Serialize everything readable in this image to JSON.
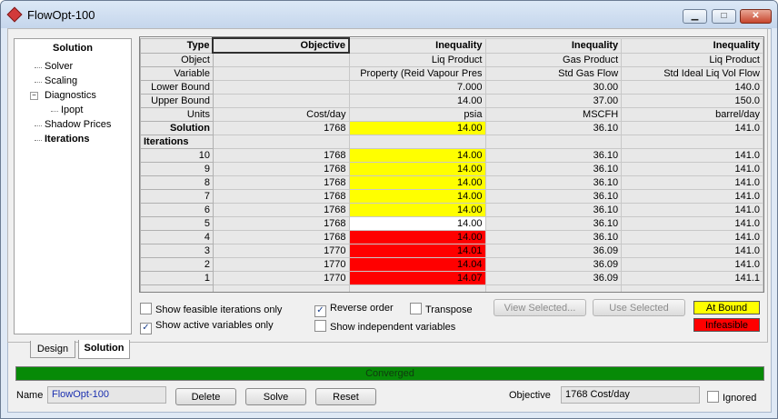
{
  "window": {
    "title": "FlowOpt-100"
  },
  "tree": {
    "title": "Solution",
    "items": [
      {
        "label": "Solver"
      },
      {
        "label": "Scaling"
      },
      {
        "label": "Diagnostics"
      },
      {
        "label": "Ipopt"
      },
      {
        "label": "Shadow Prices"
      },
      {
        "label": "Iterations"
      }
    ]
  },
  "grid": {
    "row_headers": {
      "type": "Type",
      "object": "Object",
      "variable": "Variable",
      "lower": "Lower Bound",
      "upper": "Upper Bound",
      "units": "Units",
      "solution": "Solution",
      "iterations": "Iterations"
    },
    "columns": [
      {
        "type": "Objective",
        "object": "",
        "variable": "",
        "lower": "",
        "upper": "",
        "units": "Cost/day",
        "solution": "1768"
      },
      {
        "type": "Inequality",
        "object": "Liq Product",
        "variable": "Property (Reid Vapour Pres",
        "lower": "7.000",
        "upper": "14.00",
        "units": "psia",
        "solution": "14.00"
      },
      {
        "type": "Inequality",
        "object": "Gas Product",
        "variable": "Std Gas Flow",
        "lower": "30.00",
        "upper": "37.00",
        "units": "MSCFH",
        "solution": "36.10"
      },
      {
        "type": "Inequality",
        "object": "Liq Product",
        "variable": "Std Ideal Liq Vol Flow",
        "lower": "140.0",
        "upper": "150.0",
        "units": "barrel/day",
        "solution": "141.0"
      }
    ],
    "iterations": [
      {
        "n": "10",
        "v": [
          "1768",
          "14.00",
          "36.10",
          "141.0"
        ],
        "status": "bound"
      },
      {
        "n": "9",
        "v": [
          "1768",
          "14.00",
          "36.10",
          "141.0"
        ],
        "status": "bound"
      },
      {
        "n": "8",
        "v": [
          "1768",
          "14.00",
          "36.10",
          "141.0"
        ],
        "status": "bound"
      },
      {
        "n": "7",
        "v": [
          "1768",
          "14.00",
          "36.10",
          "141.0"
        ],
        "status": "bound"
      },
      {
        "n": "6",
        "v": [
          "1768",
          "14.00",
          "36.10",
          "141.0"
        ],
        "status": "bound"
      },
      {
        "n": "5",
        "v": [
          "1768",
          "14.00",
          "36.10",
          "141.0"
        ],
        "status": "none"
      },
      {
        "n": "4",
        "v": [
          "1768",
          "14.00",
          "36.10",
          "141.0"
        ],
        "status": "infeasible"
      },
      {
        "n": "3",
        "v": [
          "1770",
          "14.01",
          "36.09",
          "141.0"
        ],
        "status": "infeasible"
      },
      {
        "n": "2",
        "v": [
          "1770",
          "14.04",
          "36.09",
          "141.0"
        ],
        "status": "infeasible"
      },
      {
        "n": "1",
        "v": [
          "1770",
          "14.07",
          "36.09",
          "141.1"
        ],
        "status": "infeasible"
      }
    ]
  },
  "options": {
    "feasible_only": {
      "label": "Show feasible iterations only",
      "checked": false
    },
    "active_only": {
      "label": "Show active variables only",
      "checked": true
    },
    "reverse_order": {
      "label": "Reverse order",
      "checked": true
    },
    "independent": {
      "label": "Show independent variables",
      "checked": false
    },
    "transpose": {
      "label": "Transpose",
      "checked": false
    }
  },
  "buttons": {
    "view_selected": "View Selected...",
    "use_selected": "Use Selected",
    "delete": "Delete",
    "solve": "Solve",
    "reset": "Reset"
  },
  "legend": {
    "at_bound": "At Bound",
    "infeasible": "Infeasible",
    "at_bound_color": "#ffff00",
    "infeasible_color": "#ff0000"
  },
  "tabs": [
    {
      "label": "Design"
    },
    {
      "label": "Solution"
    }
  ],
  "status": {
    "text": "Converged",
    "color": "#078a07"
  },
  "footer": {
    "name_label": "Name",
    "name_value": "FlowOpt-100",
    "objective_label": "Objective",
    "objective_value": "1768 Cost/day",
    "ignored_label": "Ignored",
    "ignored_checked": false
  }
}
